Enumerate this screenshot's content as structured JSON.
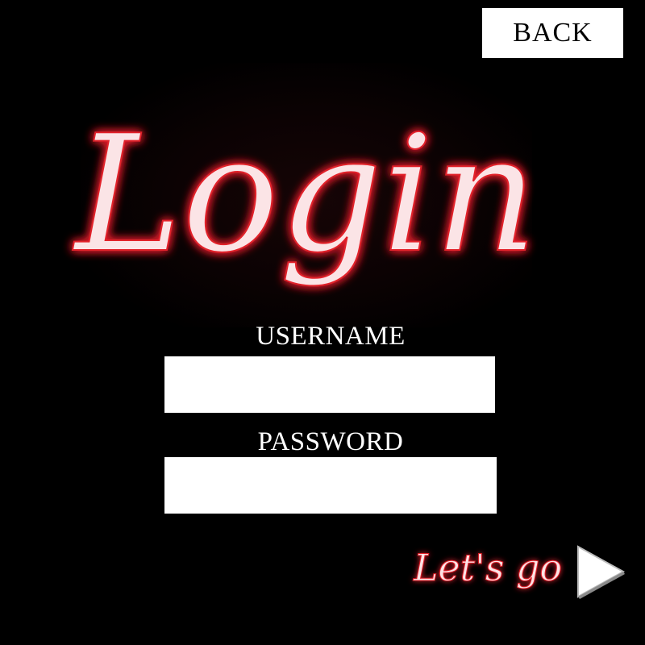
{
  "header": {
    "back_label": "BACK"
  },
  "logo": {
    "title": "Login",
    "glow_color": "#e2202c",
    "text_color": "#fbe4e6"
  },
  "form": {
    "username": {
      "label": "USERNAME",
      "value": ""
    },
    "password": {
      "label": "PASSWORD",
      "value": ""
    }
  },
  "submit": {
    "label": "Let's go",
    "icon": "play-arrow-icon"
  },
  "colors": {
    "background": "#000000",
    "neon_red": "#e2202c",
    "field_background": "#ffffff"
  }
}
